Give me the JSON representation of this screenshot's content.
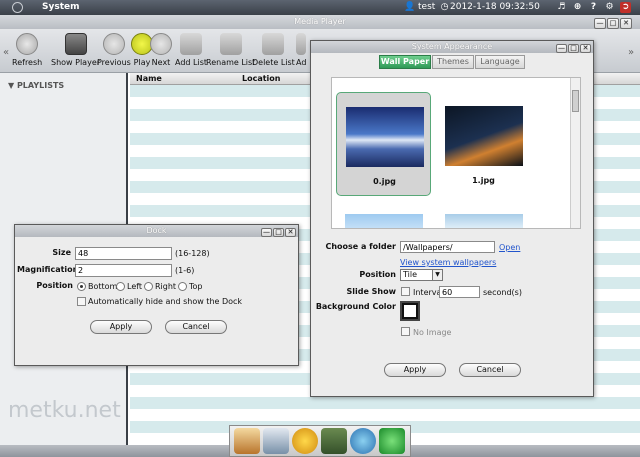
{
  "system_bar": {
    "title": "System",
    "user": "test",
    "datetime": "2012-1-18 09:32:50"
  },
  "media_player": {
    "window_title": "Media Player",
    "toolbar": {
      "refresh": "Refresh",
      "show_player": "Show Player",
      "previous": "Previous",
      "play": "Play",
      "next": "Next",
      "add_list": "Add List",
      "rename_list": "Rename List",
      "delete_list": "Delete List",
      "add_truncated": "Ad"
    },
    "sidebar": {
      "playlists": "PLAYLISTS"
    },
    "columns": {
      "name": "Name",
      "location": "Location"
    }
  },
  "dock_dialog": {
    "title": "Dock",
    "size_label": "Size",
    "size_value": "48",
    "size_range": "(16-128)",
    "magnification_label": "Magnification",
    "magnification_value": "2",
    "magnification_range": "(1-6)",
    "position_label": "Position",
    "positions": [
      "Bottom",
      "Left",
      "Right",
      "Top"
    ],
    "selected_position": "Bottom",
    "autohide_label": "Automatically hide and show the Dock",
    "apply": "Apply",
    "cancel": "Cancel"
  },
  "appearance_dialog": {
    "title": "System Appearance",
    "tabs": [
      "Wall Paper",
      "Themes",
      "Language"
    ],
    "active_tab": "Wall Paper",
    "wallpapers": [
      {
        "name": "0.jpg",
        "selected": true
      },
      {
        "name": "1.jpg",
        "selected": false
      }
    ],
    "choose_folder_label": "Choose a folder",
    "folder_value": "/Wallpapers/",
    "open_link": "Open",
    "view_system_link": "View system wallpapers",
    "position_label": "Position",
    "position_value": "Tile",
    "slideshow_label": "Slide Show",
    "interval_label": "Interval",
    "interval_value": "60",
    "interval_unit": "second(s)",
    "background_color_label": "Background Color",
    "no_image_label": "No Image",
    "apply": "Apply",
    "cancel": "Cancel"
  },
  "watermark": "metku.net"
}
